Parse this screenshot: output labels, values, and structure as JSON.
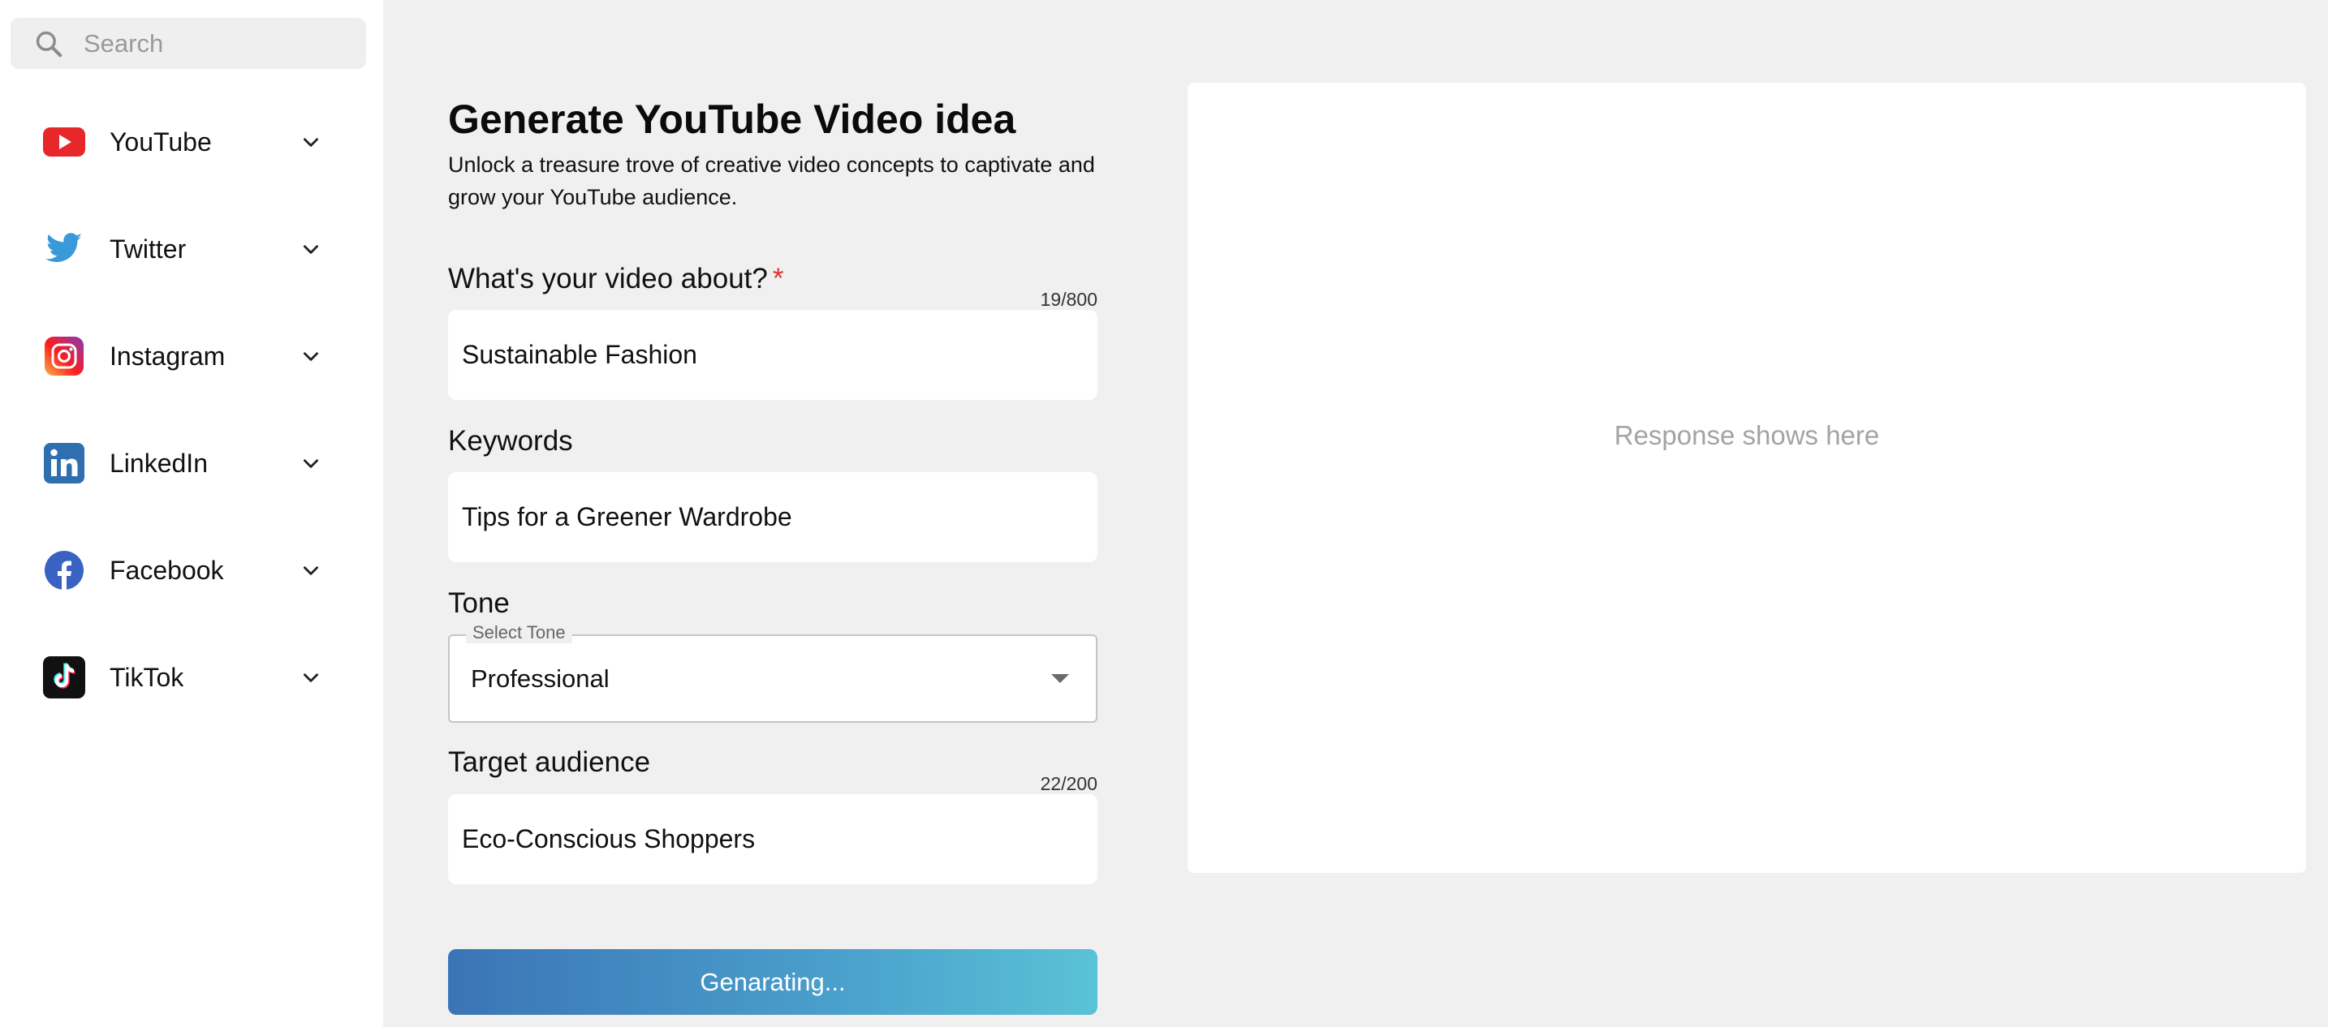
{
  "search": {
    "placeholder": "Search",
    "icon": "search-icon"
  },
  "sidebar": {
    "items": [
      {
        "label": "YouTube",
        "icon": "youtube-icon"
      },
      {
        "label": "Twitter",
        "icon": "twitter-icon"
      },
      {
        "label": "Instagram",
        "icon": "instagram-icon"
      },
      {
        "label": "LinkedIn",
        "icon": "linkedin-icon"
      },
      {
        "label": "Facebook",
        "icon": "facebook-icon"
      },
      {
        "label": "TikTok",
        "icon": "tiktok-icon"
      }
    ]
  },
  "form": {
    "title": "Generate YouTube Video idea",
    "subtitle": "Unlock a treasure trove of creative video concepts to captivate and grow your YouTube audience.",
    "about": {
      "label": "What's your video about?",
      "required_mark": "*",
      "counter": "19/800",
      "value": "Sustainable Fashion"
    },
    "keywords": {
      "label": "Keywords",
      "value": "Tips for a Greener Wardrobe"
    },
    "tone": {
      "label": "Tone",
      "select_legend": "Select Tone",
      "value": "Professional"
    },
    "audience": {
      "label": "Target audience",
      "counter": "22/200",
      "value": "Eco-Conscious Shoppers"
    },
    "generate_button": "Genarating..."
  },
  "response": {
    "placeholder": "Response shows here"
  },
  "colors": {
    "accent_gradient_start": "#3b74b6",
    "accent_gradient_end": "#5ac2d6",
    "required": "#e03131",
    "background": "#f0f0f0"
  }
}
